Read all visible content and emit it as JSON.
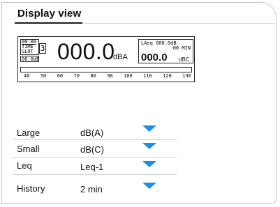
{
  "window": {
    "title": "Display view"
  },
  "lcd": {
    "time": "00:00",
    "time_label": "TIME",
    "slot_label": "SLOT",
    "slot_number": "3",
    "level_small": "00.0dB",
    "big_value": "000.0",
    "big_unit": "dBA",
    "leq_label": "LAeq 000.0dB",
    "leq_period": "00 MIN",
    "secondary_value": "000.0",
    "secondary_unit": "dBC",
    "scale": [
      "40",
      "50",
      "60",
      "70",
      "80",
      "90",
      "100",
      "110",
      "120",
      "130"
    ]
  },
  "settings": {
    "large": {
      "label": "Large",
      "value": "dB(A)"
    },
    "small": {
      "label": "Small",
      "value": "dB(C)"
    },
    "leq": {
      "label": "Leq",
      "value": "Leq-1"
    },
    "history": {
      "label": "History",
      "value": "2 min"
    }
  }
}
